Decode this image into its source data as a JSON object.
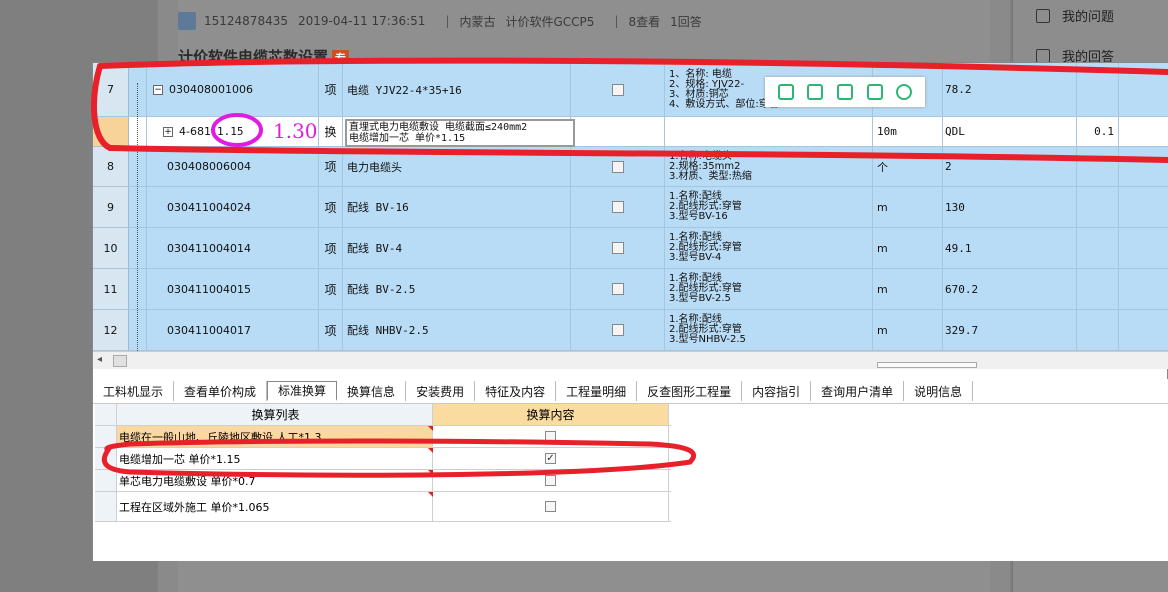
{
  "page": {
    "user_id": "15124878435",
    "timestamp": "2019-04-11 17:36:51",
    "region": "内蒙古",
    "software": "计价软件GCCP5",
    "views": "8查看",
    "answers": "1回答",
    "question_title": "计价软件电缆芯数设置",
    "title_tag": "专",
    "side_links": [
      "我的问题",
      "我的回答"
    ]
  },
  "grid": {
    "rows": [
      {
        "idx": "7",
        "code": "030408001006",
        "unit": "项",
        "name": "电缆 YJV22-4*35+16",
        "features": [
          "1、名称: 电缆",
          "2、规格:  YJV22-",
          "3、材质:铜芯",
          "4、敷设方式、部位:穿管"
        ],
        "unit2": "",
        "qty": "78.2"
      },
      {
        "idx": "8",
        "code": "030408006004",
        "unit": "项",
        "name": "电力电缆头",
        "features": [
          "1.名称:电缆头",
          "2.规格:35mm2",
          "3.材质、类型:热缩"
        ],
        "unit2": "个",
        "qty": "2"
      },
      {
        "idx": "9",
        "code": "030411004024",
        "unit": "项",
        "name": "配线 BV-16",
        "features": [
          "1.名称:配线",
          "2.配线形式:穿管",
          "3.型号BV-16"
        ],
        "unit2": "m",
        "qty": "130"
      },
      {
        "idx": "10",
        "code": "030411004014",
        "unit": "项",
        "name": "配线 BV-4",
        "features": [
          "1.名称:配线",
          "2.配线形式:穿管",
          "3.型号BV-4"
        ],
        "unit2": "m",
        "qty": "49.1"
      },
      {
        "idx": "11",
        "code": "030411004015",
        "unit": "项",
        "name": "配线 BV-2.5",
        "features": [
          "1.名称:配线",
          "2.配线形式:穿管",
          "3.型号BV-2.5"
        ],
        "unit2": "m",
        "qty": "670.2"
      },
      {
        "idx": "12",
        "code": "030411004017",
        "unit": "项",
        "name": "配线 NHBV-2.5",
        "features": [
          "1.名称:配线",
          "2.配线形式:穿管",
          "3.型号NHBV-2.5"
        ],
        "unit2": "m",
        "qty": "329.7"
      }
    ],
    "sub_row": {
      "code": "4-681",
      "coeff": "1.15",
      "annotation": "1.30",
      "unit": "换",
      "name_line1": "直埋式电力电缆敷设 电缆截面≤240mm2",
      "name_line2": "电缆增加一芯 单价*1.15",
      "unit2": "10m",
      "qty": "QDL",
      "extra": "0.1"
    }
  },
  "tabs": [
    "工料机显示",
    "查看单价构成",
    "标准换算",
    "换算信息",
    "安装费用",
    "特征及内容",
    "工程量明细",
    "反查图形工程量",
    "内容指引",
    "查询用户清单",
    "说明信息"
  ],
  "active_tab": "标准换算",
  "conversion": {
    "header_list": "换算列表",
    "header_content": "换算内容",
    "items": [
      {
        "label": "电缆在一般山地、丘陵地区敷设 人工*1.3",
        "checked": false
      },
      {
        "label": "电缆增加一芯 单价*1.15",
        "checked": true
      },
      {
        "label": "单芯电力电缆敷设 单价*0.7",
        "checked": false
      },
      {
        "label": "工程在区域外施工 单价*1.065",
        "checked": false
      }
    ]
  },
  "colors": {
    "grid_bg": "#b9dcf6",
    "highlight": "#f7d39a",
    "annotation_red": "#e8202a",
    "annotation_magenta": "#e01ce0"
  }
}
